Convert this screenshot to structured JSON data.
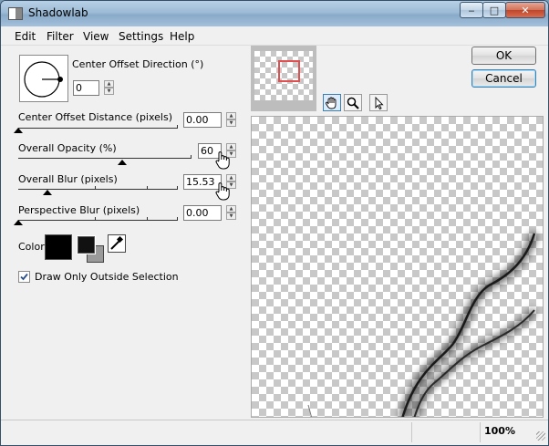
{
  "window": {
    "title": "Shadowlab"
  },
  "menu": [
    "Edit",
    "Filter",
    "View",
    "Settings",
    "Help"
  ],
  "controls": {
    "direction": {
      "label": "Center Offset Direction (°)",
      "value": "0"
    },
    "distance": {
      "label": "Center Offset Distance (pixels)",
      "value": "0.00",
      "level": 0.0
    },
    "opacity": {
      "label": "Overall Opacity (%)",
      "value": "60",
      "level": 0.6
    },
    "blur": {
      "label": "Overall Blur (pixels)",
      "value": "15.53",
      "level": 0.18
    },
    "perspective": {
      "label": "Perspective Blur (pixels)",
      "value": "0.00",
      "level": 0.0
    },
    "color": {
      "label": "Color",
      "value": "#000000"
    },
    "outside_selection": {
      "label": "Draw Only Outside Selection",
      "checked": true
    }
  },
  "buttons": {
    "ok": "OK",
    "cancel": "Cancel"
  },
  "tools": [
    "hand-tool-icon",
    "zoom-tool-icon",
    "arrow-pointer-icon"
  ],
  "status": {
    "zoom": "100%"
  }
}
